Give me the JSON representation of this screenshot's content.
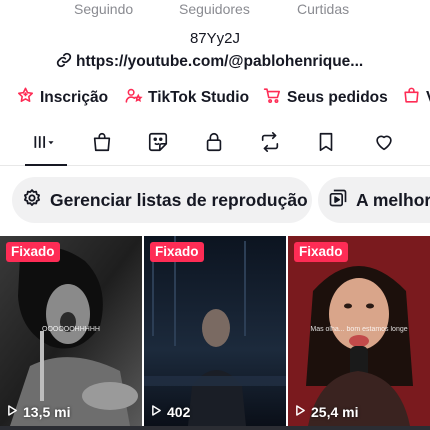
{
  "profile": {
    "stats_labels": [
      "Seguindo",
      "Seguidores",
      "Curtidas"
    ],
    "bio": "87Yy2J",
    "link": "https://youtube.com/@pablohenrique..."
  },
  "actions": [
    {
      "label": "Inscrição",
      "icon": "subscription-icon"
    },
    {
      "label": "TikTok Studio",
      "icon": "tiktok-studio-icon"
    },
    {
      "label": "Seus pedidos",
      "icon": "cart-icon"
    },
    {
      "label": "V",
      "icon": "shopping-bag-icon"
    }
  ],
  "tabs": [
    {
      "name": "videos",
      "icon": "grid-bars-icon",
      "active": true
    },
    {
      "name": "shop",
      "icon": "shopping-bag-icon"
    },
    {
      "name": "stickers",
      "icon": "sticker-icon"
    },
    {
      "name": "private",
      "icon": "lock-icon"
    },
    {
      "name": "reposts",
      "icon": "repost-icon"
    },
    {
      "name": "favorites",
      "icon": "bookmark-icon"
    },
    {
      "name": "liked",
      "icon": "heart-icon"
    }
  ],
  "chips": [
    {
      "label": "Gerenciar listas de reprodução",
      "icon": "gear-icon"
    },
    {
      "label": "A melhore",
      "icon": "playlist-icon"
    }
  ],
  "videos": [
    {
      "pinned_label": "Fixado",
      "views": "13,5 mi",
      "caption": "OOOOOOHHHHH"
    },
    {
      "pinned_label": "Fixado",
      "views": "402",
      "caption": ""
    },
    {
      "pinned_label": "Fixado",
      "views": "25,4 mi",
      "caption": "Mas olha... bom estamos longe"
    }
  ],
  "colors": {
    "accent": "#fe2c55",
    "text": "#161823",
    "muted": "#8a8b91",
    "chip_bg": "#f1f1f2"
  }
}
